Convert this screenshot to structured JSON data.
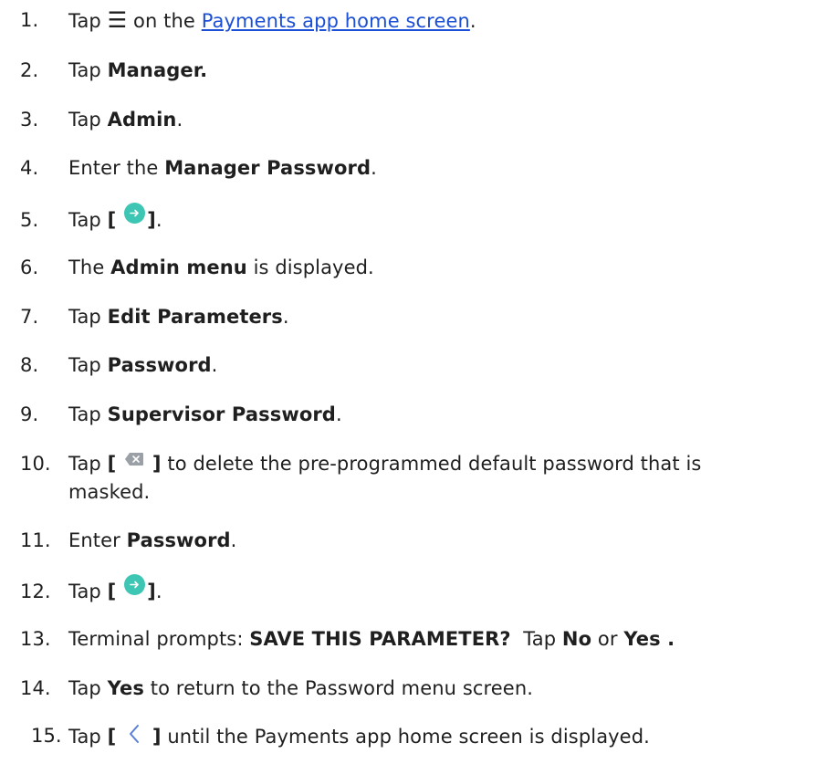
{
  "steps": [
    {
      "num": "1.",
      "parts": {
        "a": "Tap ",
        "icon": "menu-icon",
        "b": " on the ",
        "link": "Payments app home screen",
        "c": "."
      }
    },
    {
      "num": "2.",
      "parts": {
        "a": "Tap ",
        "bold": "Manager.",
        "c": ""
      }
    },
    {
      "num": "3.",
      "parts": {
        "a": "Tap ",
        "bold": "Admin",
        "c": "."
      }
    },
    {
      "num": "4.",
      "parts": {
        "a": "Enter the ",
        "bold": "Manager Password",
        "c": "."
      }
    },
    {
      "num": "5.",
      "parts": {
        "a": "Tap ",
        "open": "[",
        "icon": "enter-arrow-circle-icon",
        "close": "]",
        "c": "."
      }
    },
    {
      "num": "6.",
      "parts": {
        "a": "The ",
        "bold": "Admin menu",
        "c": " is displayed."
      }
    },
    {
      "num": "7.",
      "parts": {
        "a": "Tap ",
        "bold": "Edit Parameters",
        "c": "."
      }
    },
    {
      "num": "8.",
      "parts": {
        "a": "Tap ",
        "bold": "Password",
        "c": "."
      }
    },
    {
      "num": "9.",
      "parts": {
        "a": "Tap ",
        "bold": "Supervisor Password",
        "c": "."
      }
    },
    {
      "num": "10.",
      "parts": {
        "a": "Tap ",
        "open": "[",
        "icon": "backspace-icon",
        "close": "]",
        "c": " to delete the pre-programmed default password that is",
        "c2": "masked."
      }
    },
    {
      "num": "11.",
      "parts": {
        "a": "Enter ",
        "bold": "Password",
        "c": "."
      }
    },
    {
      "num": "12.",
      "parts": {
        "a": "Tap ",
        "open": "[",
        "icon": "enter-arrow-circle-icon",
        "close": "]",
        "c": "."
      }
    },
    {
      "num": "13.",
      "parts": {
        "a": "Terminal prompts: ",
        "bold": "SAVE THIS PARAMETER?",
        "b": "  Tap ",
        "bold2": "No",
        "d": " or ",
        "bold3": "Yes .",
        "c": ""
      }
    },
    {
      "num": "14.",
      "parts": {
        "a": "Tap ",
        "bold": "Yes",
        "c": " to return to the Password menu screen."
      }
    },
    {
      "num": "15.",
      "parts": {
        "a": "Tap ",
        "open": "[",
        "icon": "back-chevron-icon",
        "close": "]",
        "c": " until the Payments app home screen is displayed."
      }
    }
  ],
  "colors": {
    "link": "#1a4fd6",
    "icon_teal": "#3ec6b4",
    "icon_gray": "#9aa0a6",
    "chevron_blue": "#5a7fd6"
  },
  "icons": {
    "menu": "☰"
  }
}
